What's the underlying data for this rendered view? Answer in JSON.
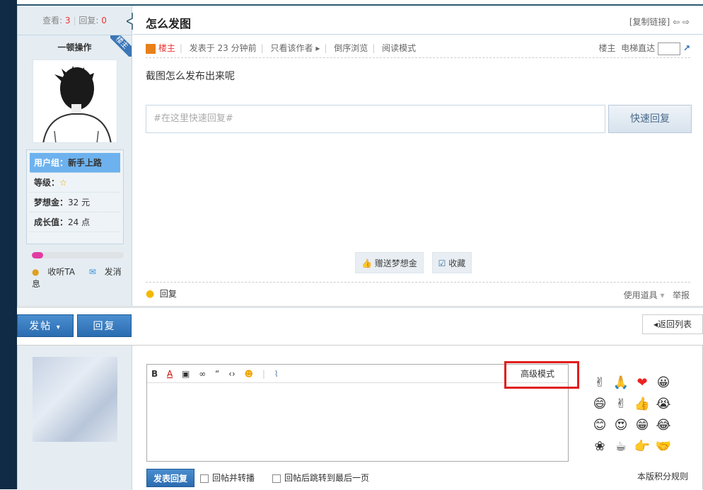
{
  "thread": {
    "views_label": "查看:",
    "views": "3",
    "replies_label": "回复:",
    "replies": "0",
    "title": "怎么发图",
    "copy_link": "[复制链接]"
  },
  "author": {
    "name": "一顿操作",
    "badge": "楼主",
    "group_label": "用户组：",
    "group": "新手上路",
    "level_label": "等级：",
    "dream_label": "梦想金：",
    "dream": "32 元",
    "growth_label": "成长值：",
    "growth": "24 点",
    "progress": 0.12,
    "follow": "收听TA",
    "message": "发消息"
  },
  "meta": {
    "louzhu": "楼主",
    "posted": "发表于 23 分钟前",
    "only_author": "只看该作者",
    "reverse": "倒序浏览",
    "read_mode": "阅读模式",
    "floor": "楼主",
    "jump_label": "电梯直达"
  },
  "content": "截图怎么发布出来呢",
  "quick_reply": {
    "placeholder": "#在这里快速回复#",
    "button": "快速回复"
  },
  "actions": {
    "give": "赠送梦想金",
    "fav": "收藏"
  },
  "footer": {
    "reply": "回复",
    "tools": "使用道具",
    "report": "举报"
  },
  "buttons": {
    "post": "发帖",
    "reply": "回复",
    "back": "返回列表"
  },
  "editor": {
    "advanced": "高级模式",
    "submit": "发表回复",
    "opt1": "回帖并转播",
    "opt2": "回帖后跳转到最后一页",
    "rules": "本版积分规则"
  }
}
